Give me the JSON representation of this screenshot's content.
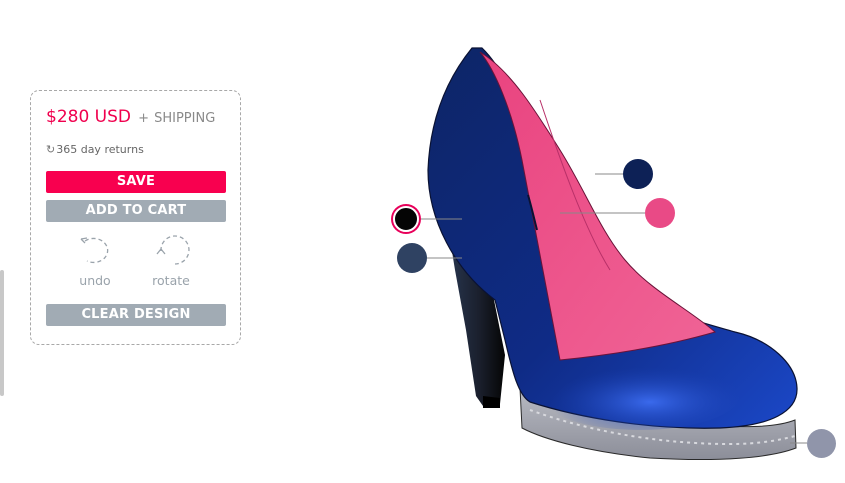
{
  "price": {
    "amount": "$280 USD",
    "separator": "+",
    "shipping": "SHIPPING"
  },
  "returns": {
    "icon": "refresh-icon",
    "text": "365 day returns"
  },
  "buttons": {
    "save": "SAVE",
    "add_to_cart": "ADD TO CART",
    "clear_design": "CLEAR DESIGN"
  },
  "tools": {
    "undo": {
      "label": "undo",
      "icon": "undo-icon"
    },
    "rotate": {
      "label": "rotate",
      "icon": "rotate-icon"
    }
  },
  "colors": {
    "accent": "#f8004f",
    "button_gray": "#a1abb4",
    "swatch_lining_black": "#050505",
    "swatch_heel": "#2f4262",
    "swatch_upper": "#0d2156",
    "swatch_lining": "#e94a86",
    "swatch_sole": "#9095aa"
  }
}
